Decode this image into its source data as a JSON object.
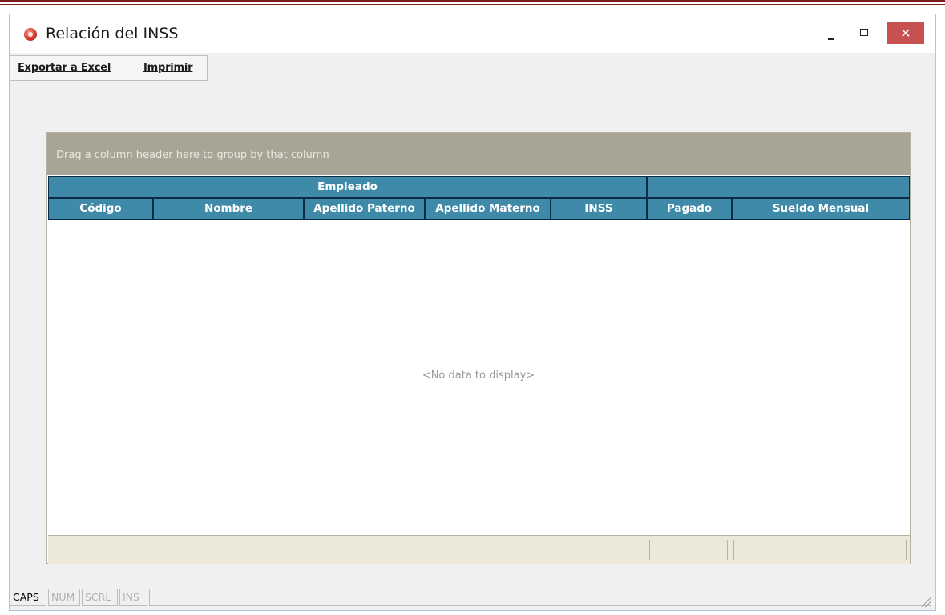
{
  "window": {
    "title": "Relación del INSS"
  },
  "toolbar": {
    "export_label": "Exportar a Excel",
    "print_label": "Imprimir"
  },
  "grid": {
    "group_hint": "Drag a column header here to group by that column",
    "band_employee": "Empleado",
    "band_other": "",
    "columns": [
      "Código",
      "Nombre",
      "Apellido Paterno",
      "Apellido Materno",
      "INSS",
      "Pagado",
      "Sueldo Mensual"
    ],
    "empty_text": "<No data to display>"
  },
  "statusbar": {
    "panels": [
      "CAPS",
      "NUM",
      "SCRL",
      "INS"
    ]
  }
}
